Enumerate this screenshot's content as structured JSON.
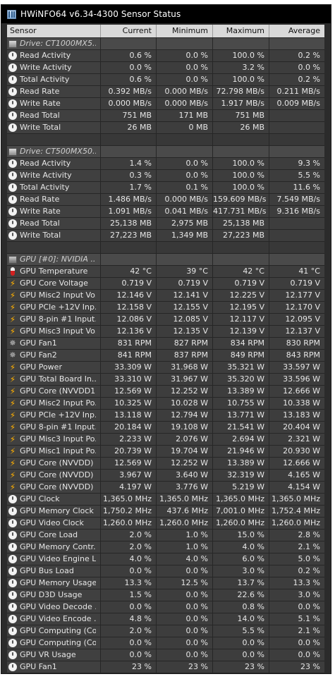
{
  "window": {
    "title": "HWiNFO64 v6.34-4300 Sensor Status"
  },
  "columns": [
    "Sensor",
    "Current",
    "Minimum",
    "Maximum",
    "Average"
  ],
  "rows": [
    {
      "kind": "group",
      "icon": "drive-icon",
      "label": "Drive: CT1000MX5..."
    },
    {
      "kind": "data",
      "icon": "clock-icon",
      "label": "Read Activity",
      "current": "0.6 %",
      "minimum": "0.0 %",
      "maximum": "100.0 %",
      "average": "0.2 %"
    },
    {
      "kind": "data",
      "icon": "clock-icon",
      "label": "Write Activity",
      "current": "0.0 %",
      "minimum": "0.0 %",
      "maximum": "3.2 %",
      "average": "0.0 %"
    },
    {
      "kind": "data",
      "icon": "clock-icon",
      "label": "Total Activity",
      "current": "0.6 %",
      "minimum": "0.0 %",
      "maximum": "100.0 %",
      "average": "0.2 %"
    },
    {
      "kind": "data",
      "icon": "clock-icon",
      "label": "Read Rate",
      "current": "0.392 MB/s",
      "minimum": "0.000 MB/s",
      "maximum": "72.798 MB/s",
      "average": "0.211 MB/s"
    },
    {
      "kind": "data",
      "icon": "clock-icon",
      "label": "Write Rate",
      "current": "0.000 MB/s",
      "minimum": "0.000 MB/s",
      "maximum": "1.917 MB/s",
      "average": "0.009 MB/s"
    },
    {
      "kind": "data",
      "icon": "clock-icon",
      "label": "Read Total",
      "current": "751 MB",
      "minimum": "171 MB",
      "maximum": "751 MB",
      "average": ""
    },
    {
      "kind": "data",
      "icon": "clock-icon",
      "label": "Write Total",
      "current": "26 MB",
      "minimum": "0 MB",
      "maximum": "26 MB",
      "average": ""
    },
    {
      "kind": "blank"
    },
    {
      "kind": "group",
      "icon": "drive-icon",
      "label": "Drive: CT500MX50..."
    },
    {
      "kind": "data",
      "icon": "clock-icon",
      "label": "Read Activity",
      "current": "1.4 %",
      "minimum": "0.0 %",
      "maximum": "100.0 %",
      "average": "9.3 %"
    },
    {
      "kind": "data",
      "icon": "clock-icon",
      "label": "Write Activity",
      "current": "0.3 %",
      "minimum": "0.0 %",
      "maximum": "100.0 %",
      "average": "5.5 %"
    },
    {
      "kind": "data",
      "icon": "clock-icon",
      "label": "Total Activity",
      "current": "1.7 %",
      "minimum": "0.1 %",
      "maximum": "100.0 %",
      "average": "11.6 %"
    },
    {
      "kind": "data",
      "icon": "clock-icon",
      "label": "Read Rate",
      "current": "1.486 MB/s",
      "minimum": "0.000 MB/s",
      "maximum": "159.609 MB/s",
      "average": "7.549 MB/s"
    },
    {
      "kind": "data",
      "icon": "clock-icon",
      "label": "Write Rate",
      "current": "1.091 MB/s",
      "minimum": "0.041 MB/s",
      "maximum": "417.731 MB/s",
      "average": "9.316 MB/s"
    },
    {
      "kind": "data",
      "icon": "clock-icon",
      "label": "Read Total",
      "current": "25,138 MB",
      "minimum": "2,975 MB",
      "maximum": "25,138 MB",
      "average": ""
    },
    {
      "kind": "data",
      "icon": "clock-icon",
      "label": "Write Total",
      "current": "27,223 MB",
      "minimum": "1,349 MB",
      "maximum": "27,223 MB",
      "average": ""
    },
    {
      "kind": "blank"
    },
    {
      "kind": "group",
      "icon": "gpu-icon",
      "label": "GPU [#0]: NVIDIA ..."
    },
    {
      "kind": "data",
      "icon": "thermometer-icon",
      "label": "GPU Temperature",
      "current": "42 °C",
      "minimum": "39 °C",
      "maximum": "42 °C",
      "average": "41 °C"
    },
    {
      "kind": "data",
      "icon": "bolt-icon",
      "label": "GPU Core Voltage",
      "current": "0.719 V",
      "minimum": "0.719 V",
      "maximum": "0.719 V",
      "average": "0.719 V"
    },
    {
      "kind": "data",
      "icon": "bolt-icon",
      "label": "GPU Misc2 Input Vo...",
      "current": "12.146 V",
      "minimum": "12.141 V",
      "maximum": "12.225 V",
      "average": "12.177 V"
    },
    {
      "kind": "data",
      "icon": "bolt-icon",
      "label": "GPU PCIe +12V Inp...",
      "current": "12.158 V",
      "minimum": "12.155 V",
      "maximum": "12.195 V",
      "average": "12.170 V"
    },
    {
      "kind": "data",
      "icon": "bolt-icon",
      "label": "GPU 8-pin #1 Input...",
      "current": "12.086 V",
      "minimum": "12.085 V",
      "maximum": "12.117 V",
      "average": "12.095 V"
    },
    {
      "kind": "data",
      "icon": "bolt-icon",
      "label": "GPU Misc3 Input Vo...",
      "current": "12.136 V",
      "minimum": "12.135 V",
      "maximum": "12.139 V",
      "average": "12.137 V"
    },
    {
      "kind": "data",
      "icon": "fan-icon",
      "label": "GPU Fan1",
      "current": "831 RPM",
      "minimum": "827 RPM",
      "maximum": "834 RPM",
      "average": "830 RPM"
    },
    {
      "kind": "data",
      "icon": "fan-icon",
      "label": "GPU Fan2",
      "current": "841 RPM",
      "minimum": "837 RPM",
      "maximum": "849 RPM",
      "average": "843 RPM"
    },
    {
      "kind": "data",
      "icon": "bolt-icon",
      "label": "GPU Power",
      "current": "33.309 W",
      "minimum": "31.968 W",
      "maximum": "35.321 W",
      "average": "33.597 W"
    },
    {
      "kind": "data",
      "icon": "bolt-icon",
      "label": "GPU Total Board In...",
      "current": "33.310 W",
      "minimum": "31.967 W",
      "maximum": "35.320 W",
      "average": "33.596 W"
    },
    {
      "kind": "data",
      "icon": "bolt-icon",
      "label": "GPU Core (NVVDD1...",
      "current": "12.569 W",
      "minimum": "12.252 W",
      "maximum": "13.389 W",
      "average": "12.666 W"
    },
    {
      "kind": "data",
      "icon": "bolt-icon",
      "label": "GPU Misc2 Input Po...",
      "current": "10.325 W",
      "minimum": "10.028 W",
      "maximum": "10.755 W",
      "average": "10.338 W"
    },
    {
      "kind": "data",
      "icon": "bolt-icon",
      "label": "GPU PCIe +12V Inp...",
      "current": "13.118 W",
      "minimum": "12.794 W",
      "maximum": "13.771 W",
      "average": "13.183 W"
    },
    {
      "kind": "data",
      "icon": "bolt-icon",
      "label": "GPU 8-pin #1 Input...",
      "current": "20.184 W",
      "minimum": "19.108 W",
      "maximum": "21.541 W",
      "average": "20.404 W"
    },
    {
      "kind": "data",
      "icon": "bolt-icon",
      "label": "GPU Misc3 Input Po...",
      "current": "2.233 W",
      "minimum": "2.076 W",
      "maximum": "2.694 W",
      "average": "2.321 W"
    },
    {
      "kind": "data",
      "icon": "bolt-icon",
      "label": "GPU Misc1 Input Po...",
      "current": "20.739 W",
      "minimum": "19.704 W",
      "maximum": "21.946 W",
      "average": "20.930 W"
    },
    {
      "kind": "data",
      "icon": "bolt-icon",
      "label": "GPU Core (NVVDD) ...",
      "current": "12.569 W",
      "minimum": "12.252 W",
      "maximum": "13.389 W",
      "average": "12.666 W"
    },
    {
      "kind": "data",
      "icon": "bolt-icon",
      "label": "GPU Core (NVVDD) ...",
      "current": "3.967 W",
      "minimum": "3.640 W",
      "maximum": "32.319 W",
      "average": "4.165 W"
    },
    {
      "kind": "data",
      "icon": "bolt-icon",
      "label": "GPU Core (NVVDD) ...",
      "current": "4.197 W",
      "minimum": "3.776 W",
      "maximum": "5.219 W",
      "average": "4.154 W"
    },
    {
      "kind": "data",
      "icon": "clock-icon",
      "label": "GPU Clock",
      "current": "1,365.0 MHz",
      "minimum": "1,365.0 MHz",
      "maximum": "1,365.0 MHz",
      "average": "1,365.0 MHz"
    },
    {
      "kind": "data",
      "icon": "clock-icon",
      "label": "GPU Memory Clock",
      "current": "1,750.2 MHz",
      "minimum": "437.6 MHz",
      "maximum": "7,001.0 MHz",
      "average": "1,752.4 MHz"
    },
    {
      "kind": "data",
      "icon": "clock-icon",
      "label": "GPU Video Clock",
      "current": "1,260.0 MHz",
      "minimum": "1,260.0 MHz",
      "maximum": "1,260.0 MHz",
      "average": "1,260.0 MHz"
    },
    {
      "kind": "data",
      "icon": "clock-icon",
      "label": "GPU Core Load",
      "current": "2.0 %",
      "minimum": "1.0 %",
      "maximum": "15.0 %",
      "average": "2.8 %"
    },
    {
      "kind": "data",
      "icon": "clock-icon",
      "label": "GPU Memory Contr...",
      "current": "2.0 %",
      "minimum": "1.0 %",
      "maximum": "4.0 %",
      "average": "2.1 %"
    },
    {
      "kind": "data",
      "icon": "clock-icon",
      "label": "GPU Video Engine L...",
      "current": "4.0 %",
      "minimum": "4.0 %",
      "maximum": "6.0 %",
      "average": "5.0 %"
    },
    {
      "kind": "data",
      "icon": "clock-icon",
      "label": "GPU Bus Load",
      "current": "0.0 %",
      "minimum": "0.0 %",
      "maximum": "3.0 %",
      "average": "0.2 %"
    },
    {
      "kind": "data",
      "icon": "clock-icon",
      "label": "GPU Memory Usage",
      "current": "13.3 %",
      "minimum": "12.5 %",
      "maximum": "13.7 %",
      "average": "13.3 %"
    },
    {
      "kind": "data",
      "icon": "clock-icon",
      "label": "GPU D3D Usage",
      "current": "1.5 %",
      "minimum": "0.0 %",
      "maximum": "22.6 %",
      "average": "3.0 %"
    },
    {
      "kind": "data",
      "icon": "clock-icon",
      "label": "GPU Video Decode ...",
      "current": "0.0 %",
      "minimum": "0.0 %",
      "maximum": "0.8 %",
      "average": "0.0 %"
    },
    {
      "kind": "data",
      "icon": "clock-icon",
      "label": "GPU Video Encode ...",
      "current": "4.8 %",
      "minimum": "0.0 %",
      "maximum": "14.0 %",
      "average": "5.1 %"
    },
    {
      "kind": "data",
      "icon": "clock-icon",
      "label": "GPU Computing (Co...",
      "current": "2.0 %",
      "minimum": "0.0 %",
      "maximum": "5.5 %",
      "average": "2.1 %"
    },
    {
      "kind": "data",
      "icon": "clock-icon",
      "label": "GPU Computing (Co...",
      "current": "0.0 %",
      "minimum": "0.0 %",
      "maximum": "0.0 %",
      "average": "0.0 %"
    },
    {
      "kind": "data",
      "icon": "clock-icon",
      "label": "GPU VR Usage",
      "current": "0.0 %",
      "minimum": "0.0 %",
      "maximum": "0.0 %",
      "average": "0.0 %"
    },
    {
      "kind": "data",
      "icon": "clock-icon",
      "label": "GPU Fan1",
      "current": "23 %",
      "minimum": "23 %",
      "maximum": "23 %",
      "average": "23 %"
    }
  ]
}
